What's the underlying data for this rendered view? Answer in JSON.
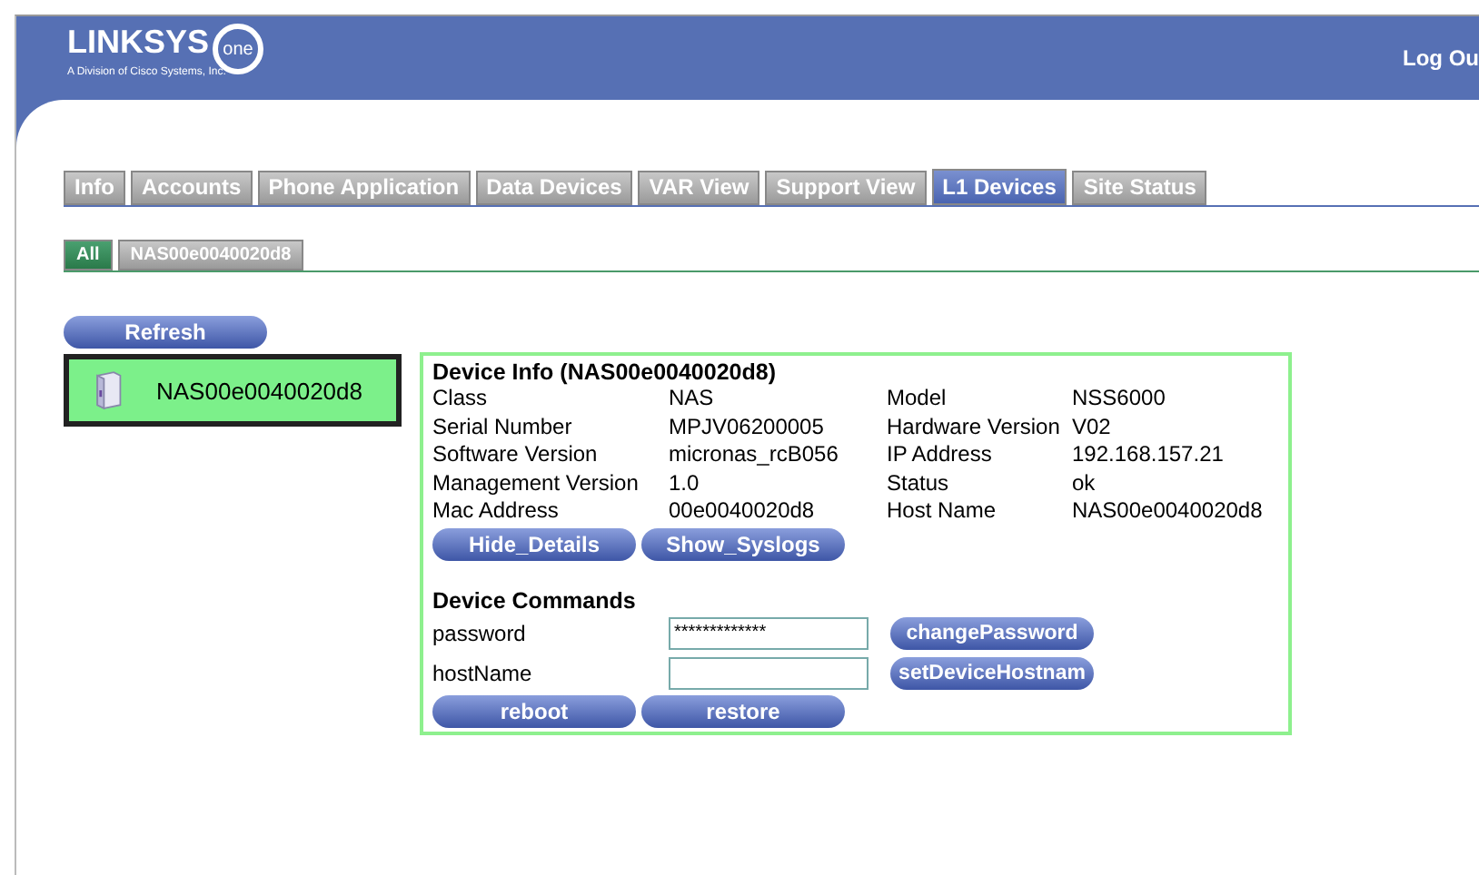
{
  "header": {
    "logo_text": "LINKSYS",
    "logo_badge": "one",
    "logo_tagline": "A Division of Cisco Systems, Inc.",
    "logout": "Log Ou"
  },
  "tabs": [
    {
      "label": "Info",
      "selected": false
    },
    {
      "label": "Accounts",
      "selected": false
    },
    {
      "label": "Phone Application",
      "selected": false
    },
    {
      "label": "Data Devices",
      "selected": false
    },
    {
      "label": "VAR View",
      "selected": false
    },
    {
      "label": "Support View",
      "selected": false
    },
    {
      "label": "L1 Devices",
      "selected": true
    },
    {
      "label": "Site Status",
      "selected": false
    }
  ],
  "subtabs": [
    {
      "label": "All",
      "selected": true
    },
    {
      "label": "NAS00e0040020d8",
      "selected": false
    }
  ],
  "refresh_button": "Refresh",
  "devices": [
    {
      "name": "NAS00e0040020d8",
      "selected": true
    }
  ],
  "device_info": {
    "title": "Device Info (NAS00e0040020d8)",
    "rows": [
      [
        "Class",
        "NAS",
        "Model",
        "NSS6000"
      ],
      [
        "Serial Number",
        "MPJV06200005",
        "Hardware Version",
        "V02"
      ],
      [
        "Software Version",
        "micronas_rcB056",
        "IP Address",
        "192.168.157.21"
      ],
      [
        "Management Version",
        "1.0",
        "Status",
        "ok"
      ],
      [
        "Mac Address",
        "00e0040020d8",
        "Host Name",
        "NAS00e0040020d8"
      ]
    ],
    "buttons": [
      "Hide_Details",
      "Show_Syslogs"
    ]
  },
  "device_commands": {
    "title": "Device Commands",
    "fields": [
      {
        "label": "password",
        "value": "*************",
        "button": "changePassword"
      },
      {
        "label": "hostName",
        "button": "setDeviceHostnam"
      }
    ],
    "buttons": [
      "reboot",
      "restore"
    ]
  }
}
